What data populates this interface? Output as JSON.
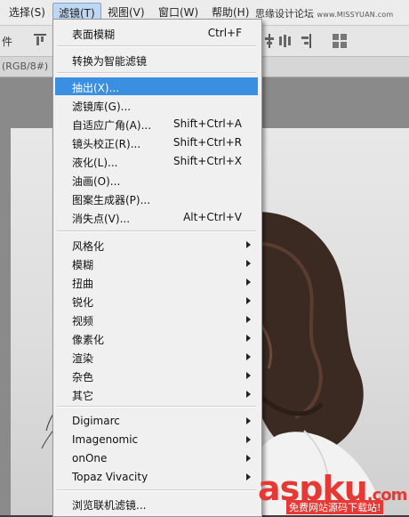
{
  "menubar": {
    "items": [
      {
        "label": "选择(S)"
      },
      {
        "label": "滤镜(T)"
      },
      {
        "label": "视图(V)"
      },
      {
        "label": "窗口(W)"
      },
      {
        "label": "帮助(H)"
      }
    ],
    "watermark": "思缘设计论坛",
    "watermark_site": "www.MISSYUAN.com"
  },
  "toolbar": {
    "left_text": "件"
  },
  "doc_tab": {
    "label": "(RGB/8#)"
  },
  "filter_menu": {
    "items": [
      {
        "label": "表面模糊",
        "shortcut": "Ctrl+F"
      },
      {
        "label": "转换为智能滤镜",
        "shortcut": ""
      },
      {
        "label": "抽出(X)...",
        "shortcut": ""
      },
      {
        "label": "滤镜库(G)...",
        "shortcut": ""
      },
      {
        "label": "自适应广角(A)...",
        "shortcut": "Shift+Ctrl+A"
      },
      {
        "label": "镜头校正(R)...",
        "shortcut": "Shift+Ctrl+R"
      },
      {
        "label": "液化(L)...",
        "shortcut": "Shift+Ctrl+X"
      },
      {
        "label": "油画(O)...",
        "shortcut": ""
      },
      {
        "label": "图案生成器(P)...",
        "shortcut": ""
      },
      {
        "label": "消失点(V)...",
        "shortcut": "Alt+Ctrl+V"
      },
      {
        "label": "风格化",
        "shortcut": ""
      },
      {
        "label": "模糊",
        "shortcut": ""
      },
      {
        "label": "扭曲",
        "shortcut": ""
      },
      {
        "label": "锐化",
        "shortcut": ""
      },
      {
        "label": "视频",
        "shortcut": ""
      },
      {
        "label": "像素化",
        "shortcut": ""
      },
      {
        "label": "渲染",
        "shortcut": ""
      },
      {
        "label": "杂色",
        "shortcut": ""
      },
      {
        "label": "其它",
        "shortcut": ""
      },
      {
        "label": "Digimarc",
        "shortcut": ""
      },
      {
        "label": "Imagenomic",
        "shortcut": ""
      },
      {
        "label": "onOne",
        "shortcut": ""
      },
      {
        "label": "Topaz Vivacity",
        "shortcut": ""
      },
      {
        "label": "浏览联机滤镜...",
        "shortcut": ""
      }
    ]
  },
  "brand": {
    "main": "aspku",
    "suffix": ".com",
    "tagline": "免费网站源码下载站!"
  },
  "colors": {
    "highlight": "#3a8fe0",
    "brand_red": "#e53935"
  }
}
